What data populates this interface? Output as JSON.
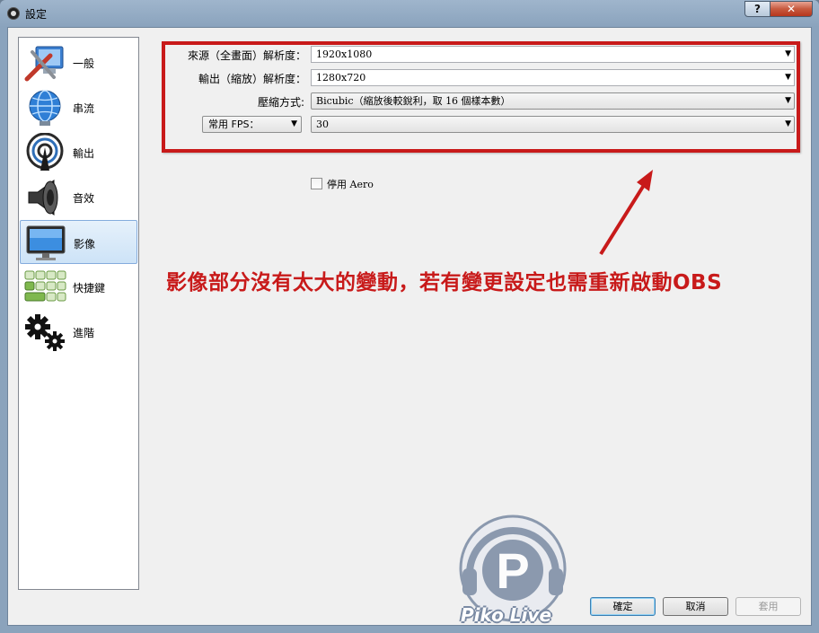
{
  "window": {
    "title": "設定",
    "help_label": "?",
    "close_label": "✕"
  },
  "sidebar": {
    "items": [
      {
        "label": "一般",
        "icon": "general-icon"
      },
      {
        "label": "串流",
        "icon": "stream-globe-icon"
      },
      {
        "label": "輸出",
        "icon": "output-broadcast-icon"
      },
      {
        "label": "音效",
        "icon": "speaker-icon"
      },
      {
        "label": "影像",
        "icon": "monitor-icon",
        "selected": true
      },
      {
        "label": "快捷鍵",
        "icon": "hotkeys-icon"
      },
      {
        "label": "進階",
        "icon": "gears-icon"
      }
    ]
  },
  "video": {
    "base_resolution_label": "來源（全畫面）解析度：",
    "base_resolution_value": "1920x1080",
    "output_resolution_label": "輸出（縮放）解析度：",
    "output_resolution_value": "1280x720",
    "downscale_filter_label": "壓縮方式:",
    "downscale_filter_value": "Bicubic（縮放後較銳利，取 16 個樣本數）",
    "fps_type_value": "常用 FPS：",
    "fps_value": "30",
    "disable_aero_label": "停用 Aero",
    "disable_aero_checked": false
  },
  "annotation": {
    "text": "影像部分沒有太大的變動，若有變更設定也需重新啟動OBS",
    "color": "#c81a1a"
  },
  "buttons": {
    "ok": "確定",
    "cancel": "取消",
    "apply": "套用"
  },
  "watermark": {
    "letter": "P",
    "text": "Piko Live"
  }
}
